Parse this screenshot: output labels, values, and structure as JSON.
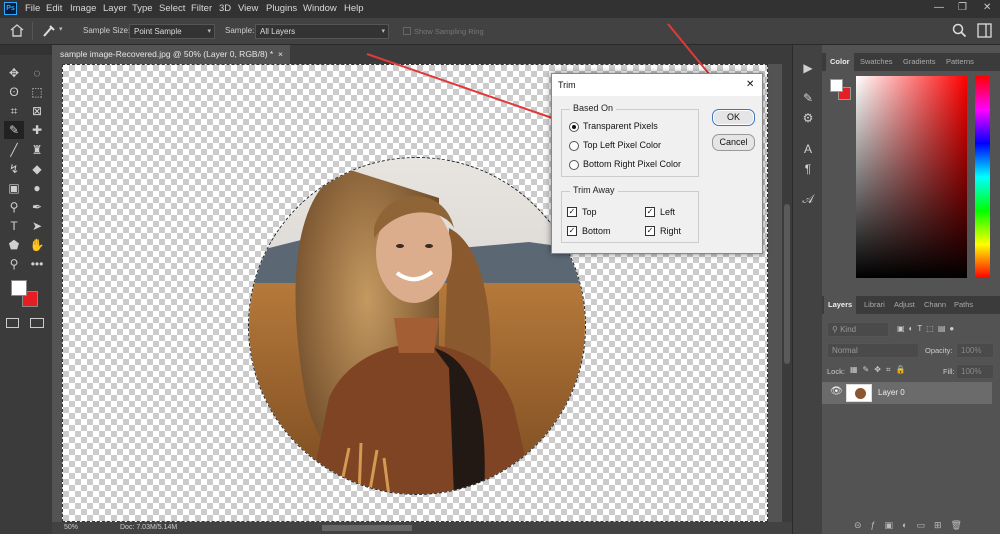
{
  "app": {
    "logo": "Ps"
  },
  "menu": [
    "File",
    "Edit",
    "Image",
    "Layer",
    "Type",
    "Select",
    "Filter",
    "3D",
    "View",
    "Plugins",
    "Window",
    "Help"
  ],
  "options": {
    "sample_size_label": "Sample Size:",
    "sample_size_value": "Point Sample",
    "sample_label": "Sample:",
    "sample_value": "All Layers",
    "show_ring": "Show Sampling Ring"
  },
  "document": {
    "tab_title": "sample image-Recovered.jpg @ 50% (Layer 0, RGB/8) *",
    "close": "×"
  },
  "status": {
    "zoom": "50%",
    "doc": "Doc: 7.03M/5.14M"
  },
  "trim_dialog": {
    "title": "Trim",
    "close": "✕",
    "based_on_title": "Based On",
    "based_on_options": [
      "Transparent Pixels",
      "Top Left Pixel Color",
      "Bottom Right Pixel Color"
    ],
    "based_on_selected": 0,
    "trim_away_title": "Trim Away",
    "trim_away": {
      "top": "Top",
      "bottom": "Bottom",
      "left": "Left",
      "right": "Right"
    },
    "ok": "OK",
    "cancel": "Cancel"
  },
  "color_panel": {
    "tabs": [
      "Color",
      "Swatches",
      "Gradients",
      "Patterns"
    ],
    "foreground": "#ffffff",
    "background": "#e31e24"
  },
  "layers_panel": {
    "tabs": [
      "Layers",
      "Librari",
      "Adjust",
      "Chann",
      "Paths"
    ],
    "filter_kind": "Kind",
    "blend_mode": "Normal",
    "opacity_label": "Opacity:",
    "opacity_value": "100%",
    "lock_label": "Lock:",
    "fill_label": "Fill:",
    "fill_value": "100%",
    "layers": [
      {
        "name": "Layer 0"
      }
    ]
  },
  "colors": {
    "accent_arrow": "#e03a3a",
    "menubar": "#323232",
    "panel": "#535353"
  }
}
